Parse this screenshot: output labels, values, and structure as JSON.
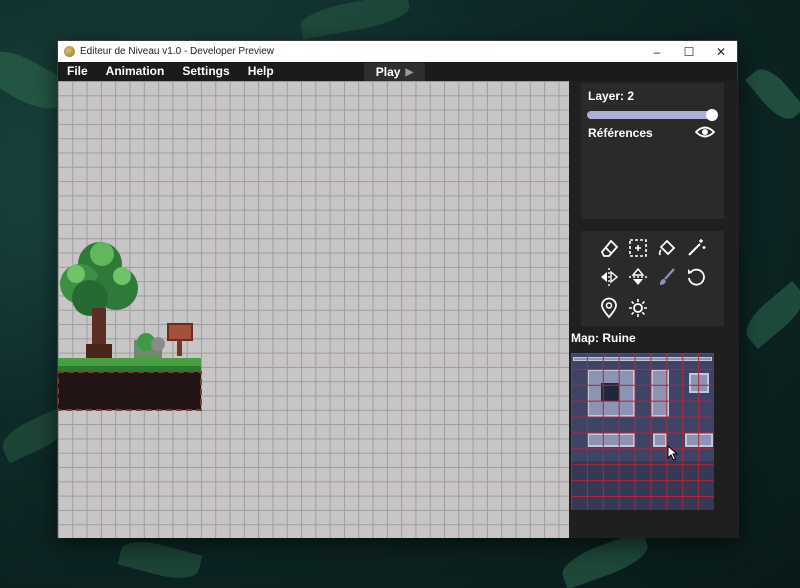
{
  "window": {
    "title": "Editeur de Niveau v1.0 - Developer Preview",
    "controls": {
      "minimize": "–",
      "maximize": "☐",
      "close": "✕"
    }
  },
  "menubar": {
    "items": [
      "File",
      "Animation",
      "Settings",
      "Help"
    ],
    "play_label": "Play",
    "play_icon": "▶"
  },
  "sidebar": {
    "layer_label": "Layer: 2",
    "layer_slider_level": 1.0,
    "references_label": "Références",
    "tools": [
      "eraser-icon",
      "select-icon",
      "fill-icon",
      "magic-wand-icon",
      "flip-horizontal-icon",
      "flip-vertical-icon",
      "brush-icon",
      "rotate-icon",
      "location-pin-icon",
      "light-icon"
    ],
    "map_label": "Map: Ruine"
  },
  "colors": {
    "canvas_bg": "#c8c5c6",
    "grid_line": "#9e9c9e",
    "tileset_bg": "#3f4466",
    "tileset_grid": "#b0263a",
    "slider": "#aab0d4"
  }
}
